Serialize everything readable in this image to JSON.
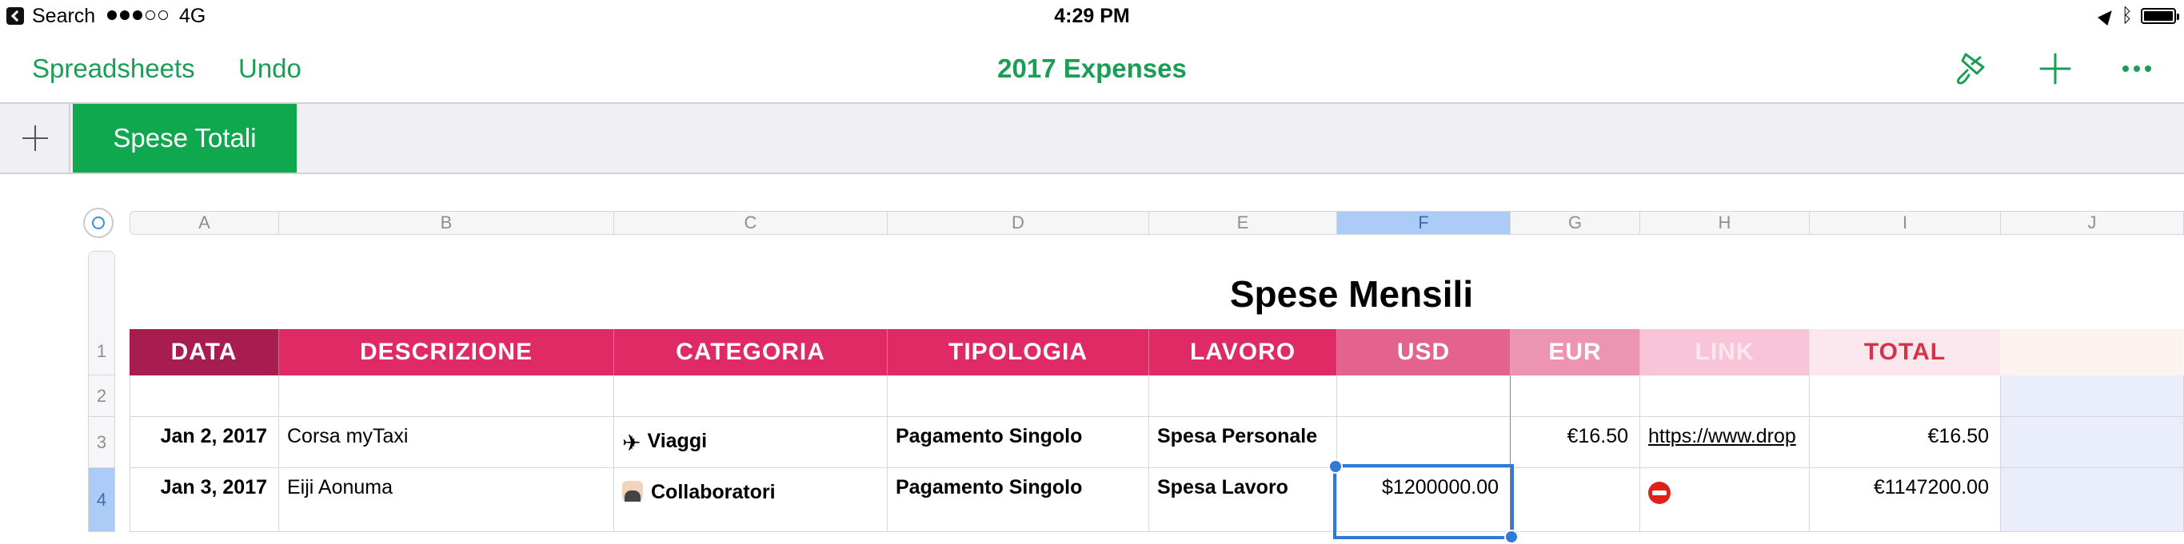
{
  "status_bar": {
    "back_label": "Search",
    "signal_bars_filled": 3,
    "signal_bars_total": 5,
    "network": "4G",
    "time": "4:29 PM",
    "icons": [
      "location-arrow-icon",
      "bluetooth-icon",
      "battery-icon"
    ]
  },
  "toolbar": {
    "spreadsheets_label": "Spreadsheets",
    "undo_label": "Undo",
    "title": "2017 Expenses",
    "icons": [
      "paintbrush-icon",
      "plus-icon",
      "more-icon"
    ],
    "accent_color": "#1a9e55"
  },
  "tabs": {
    "add_icon": "plus-icon",
    "items": [
      {
        "label": "Spese Totali",
        "active": true
      }
    ],
    "active_color": "#10a84f"
  },
  "grid": {
    "column_letters": [
      "A",
      "B",
      "C",
      "D",
      "E",
      "F",
      "G",
      "H",
      "I",
      "J"
    ],
    "selected_column": "F",
    "row_numbers": [
      "1",
      "2",
      "3",
      "4"
    ],
    "selected_row": "4",
    "sheet_title": "Spese Mensili",
    "headers": [
      "DATA",
      "DESCRIZIONE",
      "CATEGORIA",
      "TIPOLOGIA",
      "LAVORO",
      "USD",
      "EUR",
      "LINK",
      "TOTAL",
      ""
    ],
    "header_colors": [
      "#a81d50",
      "#df2a66",
      "#df2a66",
      "#df2a66",
      "#df2a66",
      "#e3628e",
      "#ee94b3",
      "#f8c4d7",
      "#fde7ee",
      "#fdf3ee"
    ],
    "rows": [
      {
        "data": "",
        "descrizione": "",
        "categoria": "",
        "tipologia": "",
        "lavoro": "",
        "usd": "",
        "eur": "",
        "link": "",
        "total": ""
      },
      {
        "data": "Jan 2, 2017",
        "descrizione": "Corsa myTaxi",
        "categoria_icon": "airplane-emoji",
        "categoria": "Viaggi",
        "tipologia": "Pagamento Singolo",
        "lavoro": "Spesa Personale",
        "usd": "",
        "eur": "€16.50",
        "link": "https://www.drop",
        "total": "€16.50"
      },
      {
        "data": "Jan 3, 2017",
        "descrizione": "Eiji Aonuma",
        "categoria_icon": "person-at-computer-emoji",
        "categoria": "Collaboratori",
        "tipologia": "Pagamento Singolo",
        "lavoro": "Spesa Lavoro",
        "usd": "$1200000.00",
        "eur": "",
        "link_icon": "no-entry-emoji",
        "link": "",
        "total": "€1147200.00"
      }
    ],
    "selected_cell": "F4",
    "selection_color": "#2f7ad7"
  }
}
